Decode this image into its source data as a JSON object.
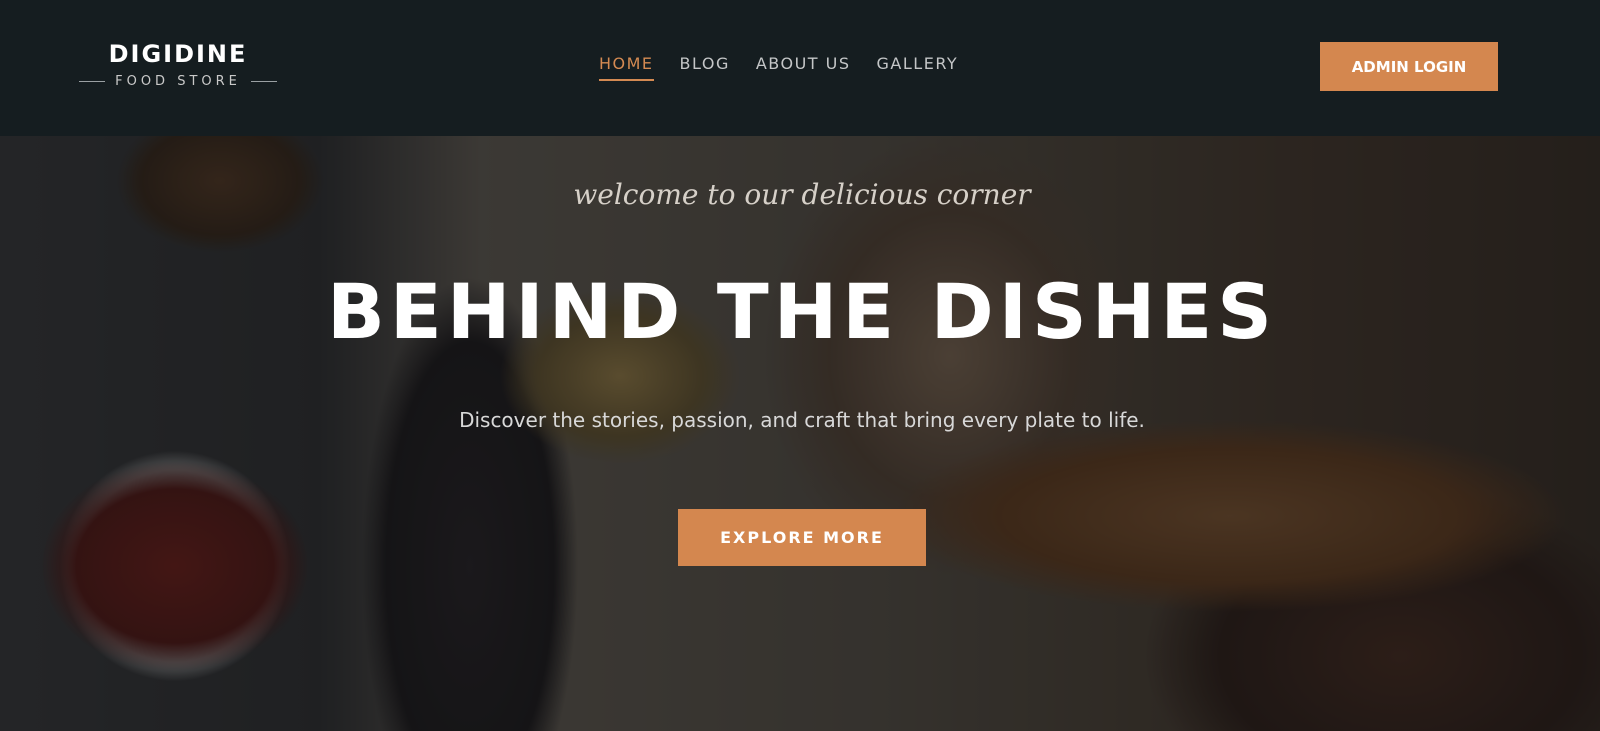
{
  "brand": {
    "name": "DIGIDINE",
    "tagline": "FOOD STORE"
  },
  "nav": {
    "items": [
      {
        "label": "HOME",
        "active": true
      },
      {
        "label": "BLOG",
        "active": false
      },
      {
        "label": "ABOUT US",
        "active": false
      },
      {
        "label": "GALLERY",
        "active": false
      }
    ]
  },
  "header": {
    "admin_label": "ADMIN LOGIN"
  },
  "hero": {
    "welcome": "welcome to our delicious corner",
    "title": "BEHIND THE DISHES",
    "description": "Discover the stories, passion, and craft that bring every plate to life.",
    "cta_label": "EXPLORE MORE",
    "background_image": "grilled-meat-platter-photo"
  },
  "colors": {
    "accent": "#d4874f",
    "header_bg": "#151d20",
    "text_light": "#ffffff",
    "nav_text": "#c4c6c7"
  }
}
